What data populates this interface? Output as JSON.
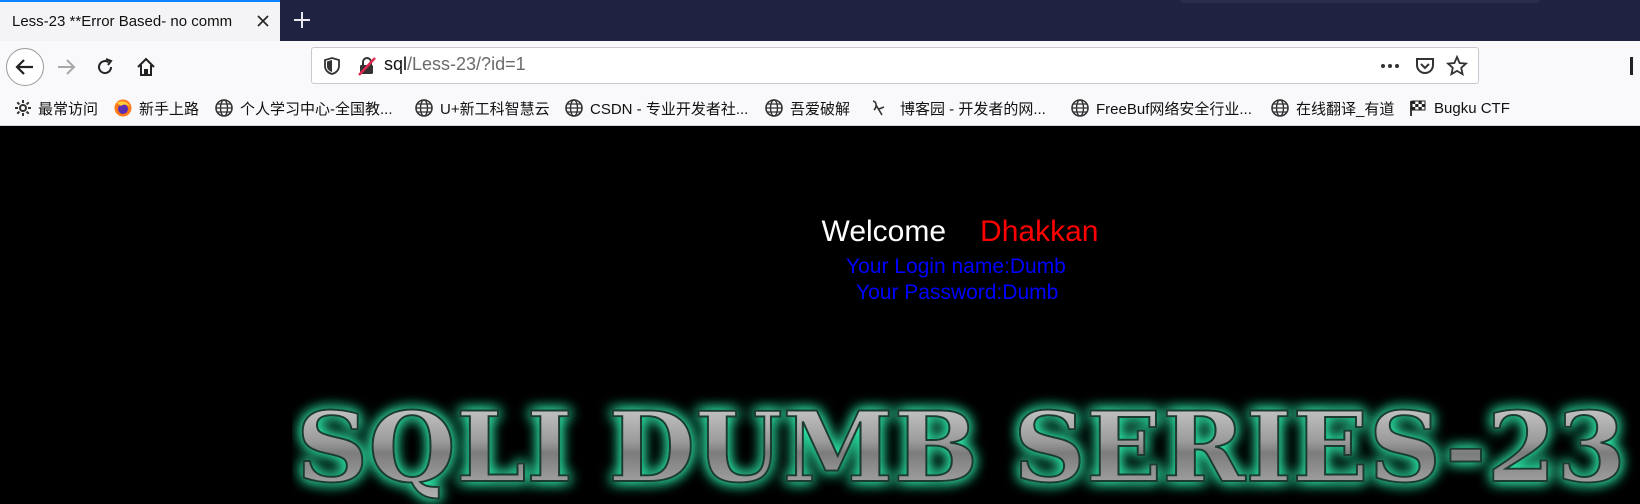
{
  "tab": {
    "title": "Less-23 **Error Based- no comm"
  },
  "navbar": {
    "url_host": "sql",
    "url_path": "/Less-23/?id=1"
  },
  "bookmarks": [
    {
      "label": "最常访问",
      "icon": "gear-icon"
    },
    {
      "label": "新手上路",
      "icon": "firefox-icon"
    },
    {
      "label": "个人学习中心-全国教...",
      "icon": "globe-icon"
    },
    {
      "label": "U+新工科智慧云",
      "icon": "globe-icon"
    },
    {
      "label": "CSDN - 专业开发者社...",
      "icon": "globe-icon"
    },
    {
      "label": "吾爱破解",
      "icon": "globe-icon"
    },
    {
      "label": "博客园 - 开发者的网...",
      "icon": "cnblogs-icon"
    },
    {
      "label": "FreeBuf网络安全行业...",
      "icon": "globe-icon"
    },
    {
      "label": "在线翻译_有道",
      "icon": "globe-icon"
    },
    {
      "label": "Bugku CTF",
      "icon": "flag-icon"
    }
  ],
  "page": {
    "welcome": "Welcome",
    "name": "Dhakkan",
    "login_line": "Your Login name:Dumb",
    "password_line": "Your Password:Dumb",
    "banner": "SQLI DUMB SERIES-23"
  },
  "colors": {
    "welcome": "#ffffff",
    "name": "#ff0000",
    "info": "#0000ff",
    "banner_glow": "#2ee6a8"
  }
}
